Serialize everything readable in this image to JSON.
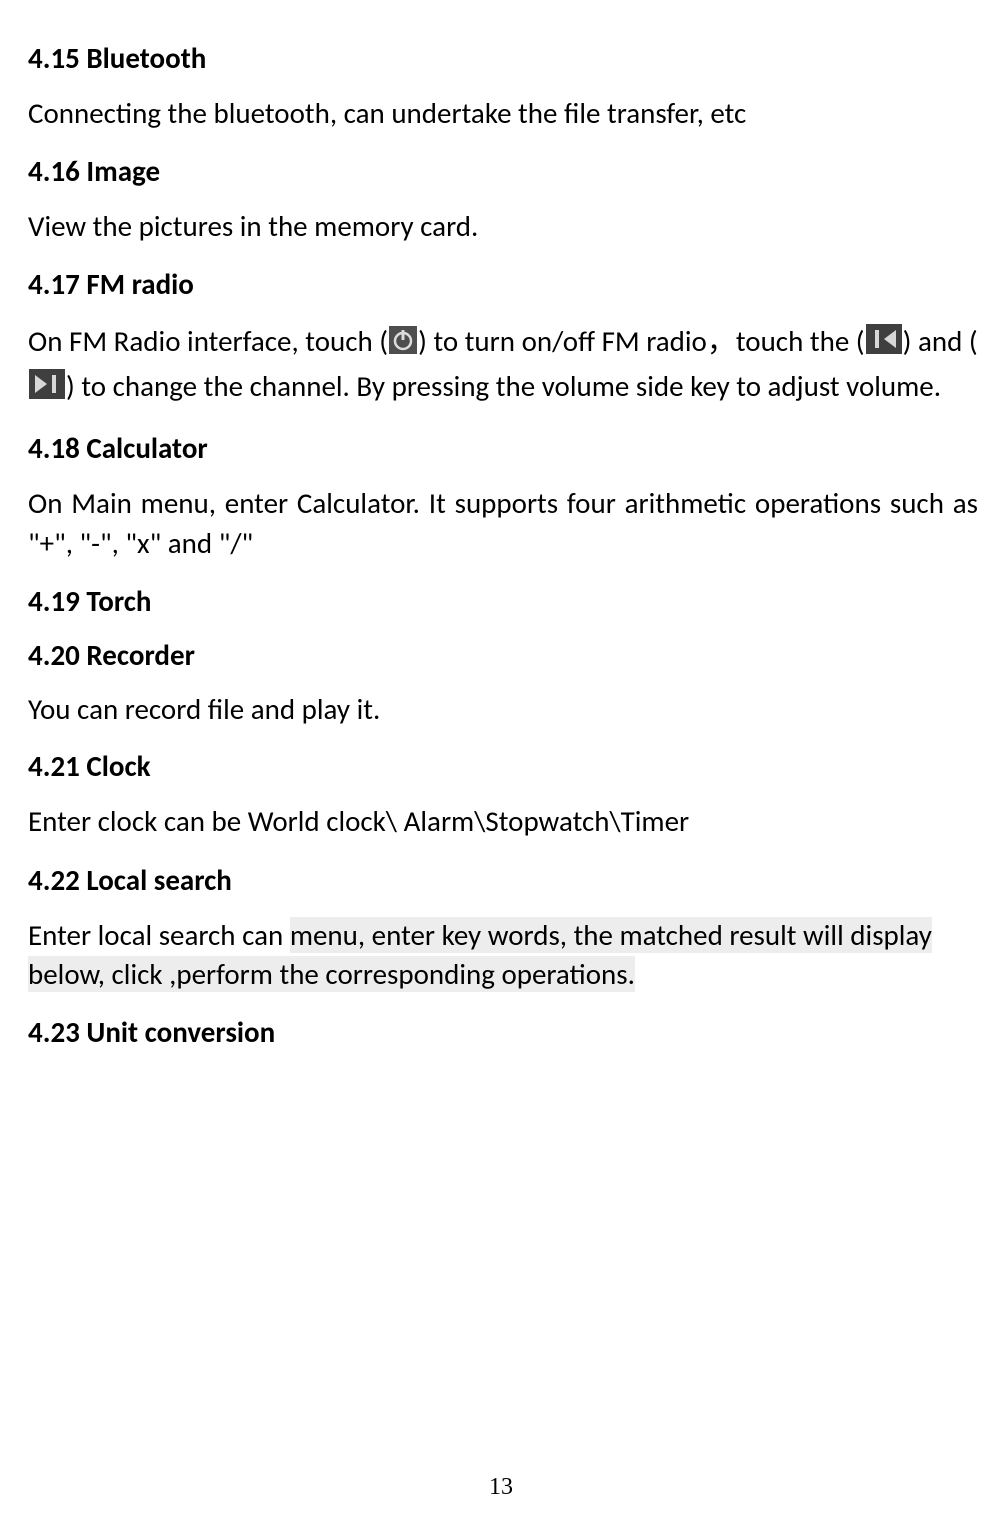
{
  "sections": {
    "h415": "4.15 Bluetooth",
    "p415": "Connecting the bluetooth, can undertake the file transfer, etc",
    "h416": "4.16 Image",
    "p416": "View the pictures in the memory card.",
    "h417": "4.17 FM radio",
    "p417a": "On FM Radio interface, touch (",
    "p417b": ") to turn on/off FM radio，touch the (",
    "p417c": ") and (",
    "p417d": ") to change the channel. By pressing the volume side key to adjust volume.",
    "h418": "4.18 Calculator",
    "p418": "On  Main  menu,  enter  Calculator. It  supports  four  arithmetic operations such as \"+\", \"-\", \"x\" and \"/\"",
    "h419": "4.19 Torch",
    "h420": "4.20 Recorder",
    "p420": "You can record file and play it.",
    "h421": "4.21 Clock",
    "p421": "Enter clock can be World clock\\ Alarm\\Stopwatch\\Timer",
    "h422": "4.22 Local search",
    "p422a": "Enter local search can ",
    "p422b": "menu, enter key words, the matched result will display below, click ,perform the corresponding operations.",
    "h423": "4.23 Unit conversion"
  },
  "page_number": "13"
}
